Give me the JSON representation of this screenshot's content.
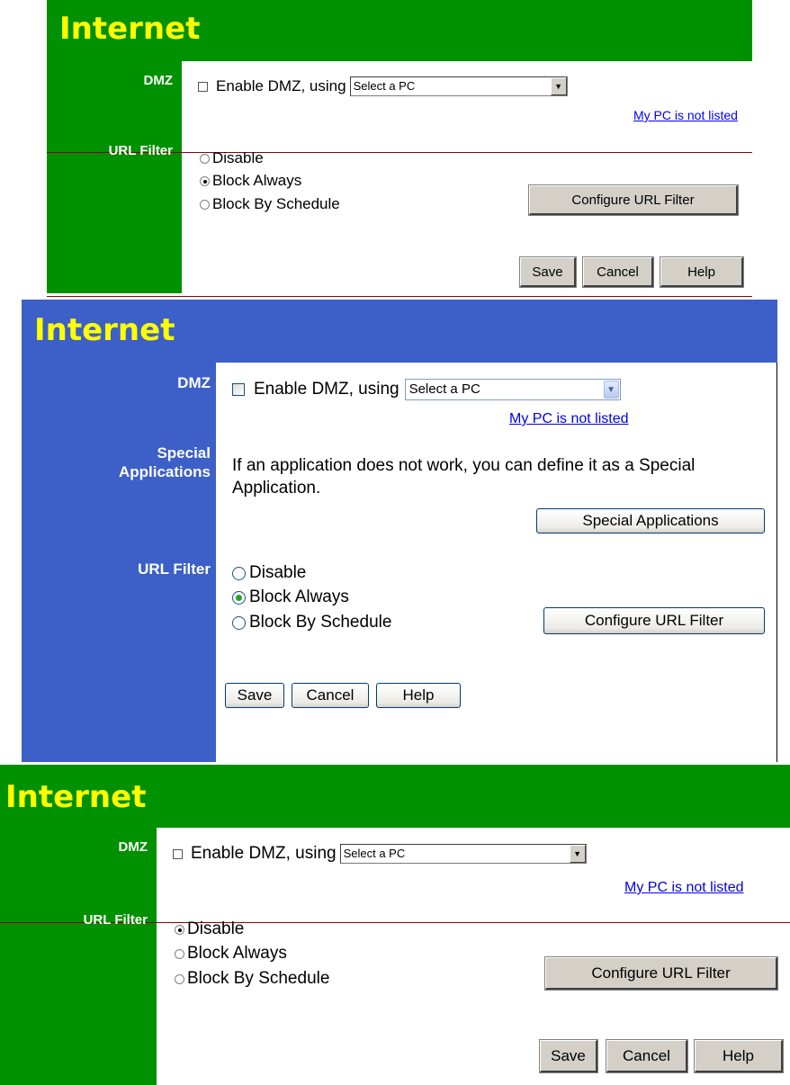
{
  "panels": [
    {
      "theme": "green",
      "colors": {
        "bar": "#009100",
        "title": "#ffff00"
      },
      "title": "Internet",
      "dmz": {
        "label": "DMZ",
        "enable_label": "Enable DMZ, using",
        "enabled": false,
        "select_value": "Select a PC",
        "link": "My PC is not listed"
      },
      "url_filter": {
        "label": "URL Filter",
        "options": [
          "Disable",
          "Block Always",
          "Block By Schedule"
        ],
        "selected": "Block Always",
        "configure_button": "Configure URL Filter"
      },
      "buttons": {
        "save": "Save",
        "cancel": "Cancel",
        "help": "Help"
      }
    },
    {
      "theme": "blue",
      "colors": {
        "bar": "#3c5fc8",
        "title": "#ffff00"
      },
      "title": "Internet",
      "dmz": {
        "label": "DMZ",
        "enable_label": "Enable DMZ, using",
        "enabled": false,
        "select_value": "Select a PC",
        "link": "My PC is not listed"
      },
      "special_applications": {
        "label_line1": "Special",
        "label_line2": "Applications",
        "text_line1": "If an application does not work, you can define it as a Special",
        "text_line2": "Application.",
        "button": "Special Applications"
      },
      "url_filter": {
        "label": "URL Filter",
        "options": [
          "Disable",
          "Block Always",
          "Block By Schedule"
        ],
        "selected": "Block Always",
        "configure_button": "Configure URL Filter"
      },
      "buttons": {
        "save": "Save",
        "cancel": "Cancel",
        "help": "Help"
      }
    },
    {
      "theme": "green",
      "colors": {
        "bar": "#009100",
        "title": "#ffff00"
      },
      "title": "Internet",
      "dmz": {
        "label": "DMZ",
        "enable_label": "Enable DMZ, using",
        "enabled": false,
        "select_value": "Select a PC",
        "link": "My PC is not listed"
      },
      "url_filter": {
        "label": "URL Filter",
        "options": [
          "Disable",
          "Block Always",
          "Block By Schedule"
        ],
        "selected": "Disable",
        "configure_button": "Configure URL Filter"
      },
      "buttons": {
        "save": "Save",
        "cancel": "Cancel",
        "help": "Help"
      }
    }
  ]
}
